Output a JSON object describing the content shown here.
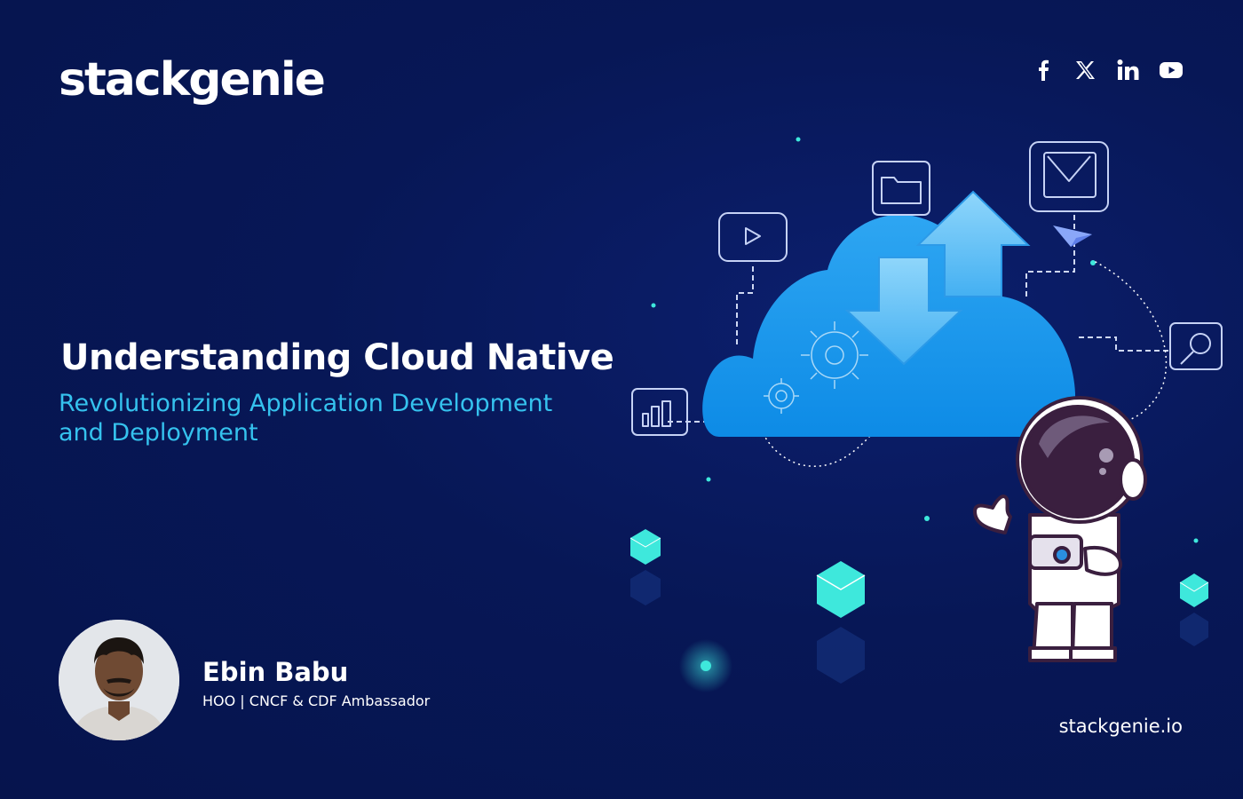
{
  "brand": {
    "logo_text": "stackgenie",
    "website": "stackgenie.io"
  },
  "social": [
    {
      "name": "facebook",
      "icon": "facebook-icon"
    },
    {
      "name": "x",
      "icon": "x-icon"
    },
    {
      "name": "linkedin",
      "icon": "linkedin-icon"
    },
    {
      "name": "youtube",
      "icon": "youtube-icon"
    }
  ],
  "headline": {
    "title": "Understanding Cloud Native",
    "subtitle": "Revolutionizing Application Development and Deployment"
  },
  "author": {
    "name": "Ebin Babu",
    "role": "HOO | CNCF & CDF Ambassador"
  },
  "illustration": {
    "icons": [
      "play-icon",
      "folder-icon",
      "mail-icon",
      "send-icon",
      "search-icon",
      "bar-chart-icon",
      "gear-icon",
      "upload-arrow-icon",
      "download-arrow-icon"
    ],
    "colors": {
      "background": "#071756",
      "cloud": "#1a9ff0",
      "accent": "#35c2ee",
      "cube": "#3ee8dc"
    }
  }
}
